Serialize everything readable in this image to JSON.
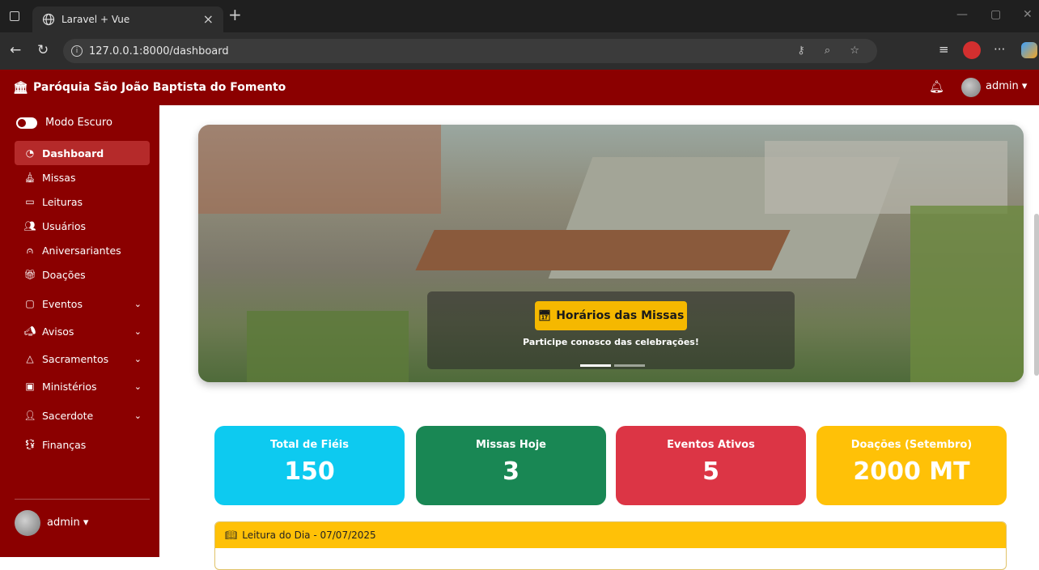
{
  "browser": {
    "tab_title": "Laravel + Vue",
    "url": "127.0.0.1:8000/dashboard"
  },
  "navbar": {
    "brand": "Paróquia São João Baptista do Fomento",
    "user": "admin"
  },
  "sidebar": {
    "dark_mode_label": "Modo Escuro",
    "items": [
      {
        "label": "Dashboard",
        "icon": "gauge-icon",
        "active": true,
        "has_children": false
      },
      {
        "label": "Missas",
        "icon": "church-icon",
        "active": false,
        "has_children": false
      },
      {
        "label": "Leituras",
        "icon": "book-open-icon",
        "active": false,
        "has_children": false
      },
      {
        "label": "Usuários",
        "icon": "users-icon",
        "active": false,
        "has_children": false
      },
      {
        "label": "Aniversariantes",
        "icon": "cake-icon",
        "active": false,
        "has_children": false
      },
      {
        "label": "Doações",
        "icon": "gift-icon",
        "active": false,
        "has_children": false
      },
      {
        "label": "Eventos",
        "icon": "calendar-icon",
        "active": false,
        "has_children": true
      },
      {
        "label": "Avisos",
        "icon": "megaphone-icon",
        "active": false,
        "has_children": true
      },
      {
        "label": "Sacramentos",
        "icon": "flame-icon",
        "active": false,
        "has_children": true
      },
      {
        "label": "Ministérios",
        "icon": "badge-icon",
        "active": false,
        "has_children": true
      },
      {
        "label": "Sacerdote",
        "icon": "person-icon",
        "active": false,
        "has_children": true
      },
      {
        "label": "Finanças",
        "icon": "money-icon",
        "active": false,
        "has_children": false
      }
    ],
    "user": "admin"
  },
  "hero": {
    "button_label": "Horários das Missas",
    "subtitle": "Participe conosco das celebrações!"
  },
  "stats": [
    {
      "label": "Total de Fiéis",
      "value": "150",
      "color": "#0dcaf0"
    },
    {
      "label": "Missas Hoje",
      "value": "3",
      "color": "#198754"
    },
    {
      "label": "Eventos Ativos",
      "value": "5",
      "color": "#dc3545"
    },
    {
      "label": "Doações (Setembro)",
      "value": "2000 MT",
      "color": "#ffc107"
    }
  ],
  "reading": {
    "title": "Leitura do Dia - 07/07/2025"
  },
  "colors": {
    "brand": "#8b0000",
    "active_item": "#b52a2a"
  }
}
